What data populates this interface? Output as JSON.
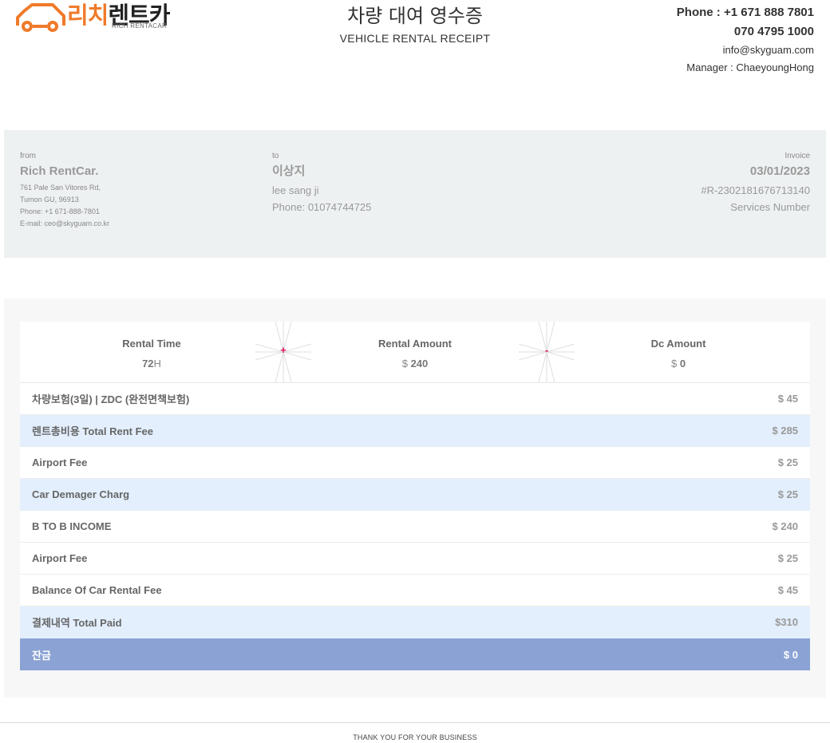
{
  "header": {
    "logo_text_accent": "리치",
    "logo_text_main": "렌트카",
    "logo_sub": "RICH RENTACAR",
    "title_ko": "차량 대여 영수증",
    "title_en": "VEHICLE RENTAL RECEIPT",
    "phone1": "Phone : +1 671 888 7801",
    "phone2": "070 4795 1000",
    "email": "info@skyguam.com",
    "manager": "Manager : ChaeyoungHong"
  },
  "from": {
    "label": "from",
    "name": "Rich RentCar.",
    "address1": "761 Pale San Vitores Rd,",
    "address2": "Tumon GU, 96913",
    "phone": "Phone: +1 671-888-7801",
    "email": "E-mail: ceo@skyguam.co.kr"
  },
  "to": {
    "label": "to",
    "name_ko": "이상지",
    "name_en": "lee sang ji",
    "phone": "Phone: 01074744725"
  },
  "invoice": {
    "label": "Invoice",
    "date": "03/01/2023",
    "number": "#R-2302181676713140",
    "services": "Services Number"
  },
  "summary": {
    "rental_time_label": "Rental Time",
    "rental_time_value": "72",
    "rental_time_unit": "H",
    "plus": "+",
    "rental_amount_label": "Rental Amount",
    "rental_amount_currency": "$",
    "rental_amount_value": "240",
    "minus": "-",
    "dc_amount_label": "Dc Amount",
    "dc_amount_currency": "$",
    "dc_amount_value": "0"
  },
  "rows": [
    {
      "label": "차량보험(3일) | ZDC (완전면책보험)",
      "value": "$ 45"
    },
    {
      "label": "렌트총비용 Total Rent Fee",
      "value": "$ 285"
    },
    {
      "label": "Airport Fee",
      "value": "$ 25"
    },
    {
      "label": "Car Demager Charg",
      "value": "$ 25"
    },
    {
      "label": "B TO B INCOME",
      "value": "$ 240"
    },
    {
      "label": "Airport Fee",
      "value": "$ 25"
    },
    {
      "label": "Balance Of Car Rental Fee",
      "value": "$ 45"
    },
    {
      "label": "결제내역 Total Paid",
      "value": "$310"
    },
    {
      "label": "잔금",
      "value": "$ 0"
    }
  ],
  "footer": "THANK YOU FOR YOUR BUSINESS",
  "colors": {
    "brand_orange": "#ef7a2a",
    "highlight_row": "#e3effd",
    "total_row": "#8ba2d4",
    "operator_pink": "#e0115f"
  }
}
